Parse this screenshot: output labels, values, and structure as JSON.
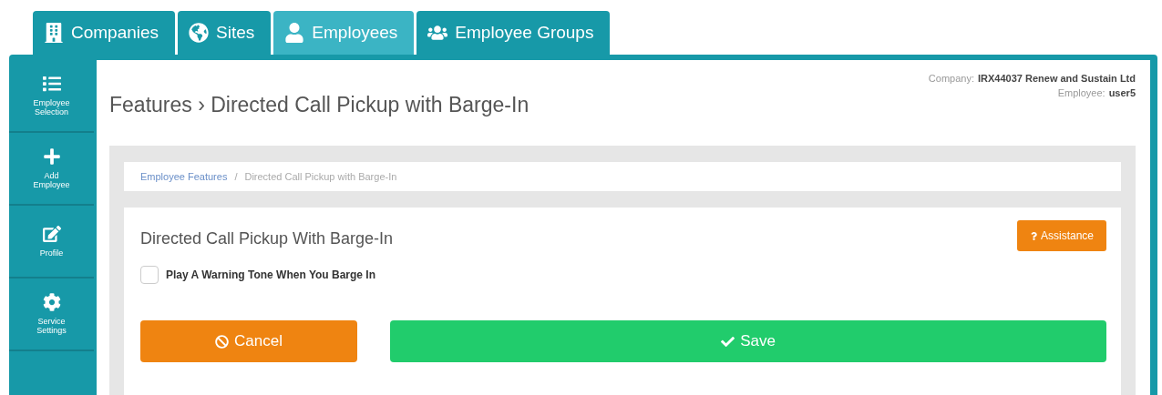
{
  "tabs": [
    {
      "label": "Companies",
      "selected": false
    },
    {
      "label": "Sites",
      "selected": false
    },
    {
      "label": "Employees",
      "selected": true
    },
    {
      "label": "Employee Groups",
      "selected": false
    }
  ],
  "sidebar": {
    "items": [
      {
        "label": "Employee Selection"
      },
      {
        "label": "Add Employee"
      },
      {
        "label": "Profile"
      },
      {
        "label": "Service Settings"
      }
    ]
  },
  "page": {
    "title": "Features › Directed Call Pickup with Barge-In",
    "company_label": "Company:",
    "company": "IRX44037 Renew and Sustain Ltd",
    "employee_label": "Employee:",
    "employee": "user5"
  },
  "breadcrumb": [
    {
      "label": "Employee Features",
      "kind": "link"
    },
    {
      "label": "/",
      "kind": "separator"
    },
    {
      "label": "Directed Call Pickup with Barge-In",
      "kind": "current"
    }
  ],
  "card": {
    "title": "Directed Call Pickup With Barge-In",
    "assistance": "Assistance",
    "checkbox": {
      "label": "Play A Warning Tone When You Barge In",
      "checked": false
    },
    "cancel": "Cancel",
    "save": "Save"
  }
}
